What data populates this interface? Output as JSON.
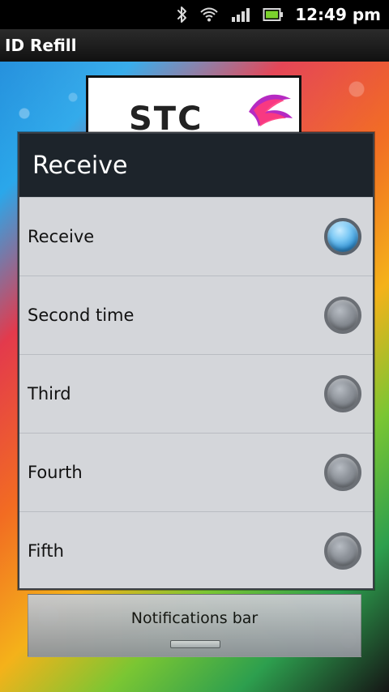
{
  "status_bar": {
    "time": "12:49 pm",
    "icons": [
      "bluetooth-icon",
      "wifi-icon",
      "signal-icon",
      "battery-icon"
    ]
  },
  "app": {
    "title": "ID Refill"
  },
  "logo": {
    "text": "STC"
  },
  "dialog": {
    "title": "Receive",
    "options": [
      {
        "label": "Receive",
        "selected": true
      },
      {
        "label": "Second time",
        "selected": false
      },
      {
        "label": "Third",
        "selected": false
      },
      {
        "label": "Fourth",
        "selected": false
      },
      {
        "label": "Fifth",
        "selected": false
      }
    ]
  },
  "notifications_bar": {
    "label": "Notifications bar"
  },
  "colors": {
    "dialog_header": "#1d242b",
    "dialog_body": "#d4d6da",
    "radio_selected": "#2f8fd2"
  }
}
